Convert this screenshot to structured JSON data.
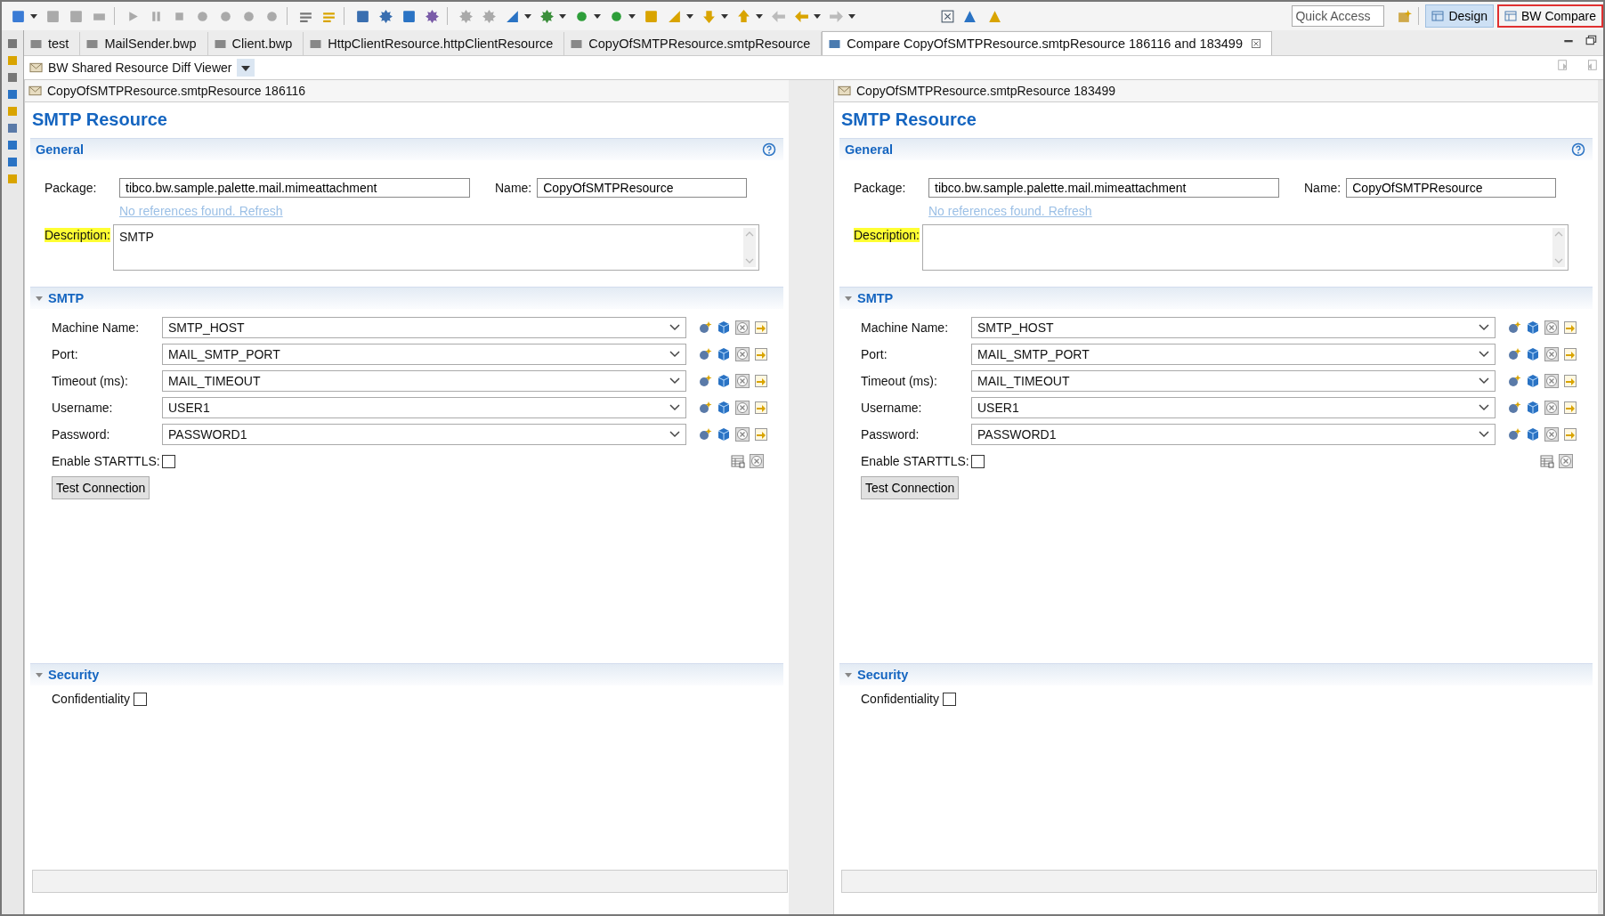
{
  "toolbar": {
    "quick_access": {
      "placeholder": "Quick Access"
    },
    "perspectives": [
      {
        "label": "Design",
        "selected": true,
        "outlined": false
      },
      {
        "label": "BW Compare",
        "selected": false,
        "outlined": true
      }
    ]
  },
  "tabs": [
    {
      "label": "test",
      "selected": false,
      "closable": false
    },
    {
      "label": "MailSender.bwp",
      "selected": false,
      "closable": false
    },
    {
      "label": "Client.bwp",
      "selected": false,
      "closable": false
    },
    {
      "label": "HttpClientResource.httpClientResource",
      "selected": false,
      "closable": false
    },
    {
      "label": "CopyOfSMTPResource.smtpResource",
      "selected": false,
      "closable": false
    },
    {
      "label": "Compare CopyOfSMTPResource.smtpResource 186116 and 183499",
      "selected": true,
      "closable": true
    }
  ],
  "viewer": {
    "title": "BW Shared Resource Diff Viewer"
  },
  "panes": [
    {
      "file": "CopyOfSMTPResource.smtpResource 186116",
      "title": "SMTP Resource",
      "general": {
        "heading": "General",
        "package_label": "Package:",
        "package": "tibco.bw.sample.palette.mail.mimeattachment",
        "name_label": "Name:",
        "name": "CopyOfSMTPResource",
        "link": "No references found. Refresh",
        "description_label": "Description:",
        "description": "SMTP"
      },
      "smtp": {
        "heading": "SMTP",
        "fields": [
          {
            "label": "Machine Name:",
            "value": "SMTP_HOST"
          },
          {
            "label": "Port:",
            "value": "MAIL_SMTP_PORT"
          },
          {
            "label": "Timeout (ms):",
            "value": "MAIL_TIMEOUT"
          },
          {
            "label": "Username:",
            "value": "USER1"
          },
          {
            "label": "Password:",
            "value": "PASSWORD1"
          }
        ],
        "starttls": {
          "label": "Enable STARTTLS:",
          "checked": false
        },
        "button": "Test Connection"
      },
      "security": {
        "heading": "Security",
        "confidentiality": {
          "label": "Confidentiality",
          "checked": false
        }
      }
    },
    {
      "file": "CopyOfSMTPResource.smtpResource 183499",
      "title": "SMTP Resource",
      "general": {
        "heading": "General",
        "package_label": "Package:",
        "package": "tibco.bw.sample.palette.mail.mimeattachment",
        "name_label": "Name:",
        "name": "CopyOfSMTPResource",
        "link": "No references found. Refresh",
        "description_label": "Description:"
      },
      "smtp": {
        "heading": "SMTP",
        "fields": [
          {
            "label": "Machine Name:",
            "value": "SMTP_HOST"
          },
          {
            "label": "Port:",
            "value": "MAIL_SMTP_PORT"
          },
          {
            "label": "Timeout (ms):",
            "value": "MAIL_TIMEOUT"
          },
          {
            "label": "Username:",
            "value": "USER1"
          },
          {
            "label": "Password:",
            "value": "PASSWORD1"
          }
        ],
        "starttls": {
          "label": "Enable STARTTLS:",
          "checked": false
        },
        "button": "Test Connection"
      },
      "security": {
        "heading": "Security",
        "confidentiality": {
          "label": "Confidentiality",
          "checked": false
        }
      }
    }
  ]
}
